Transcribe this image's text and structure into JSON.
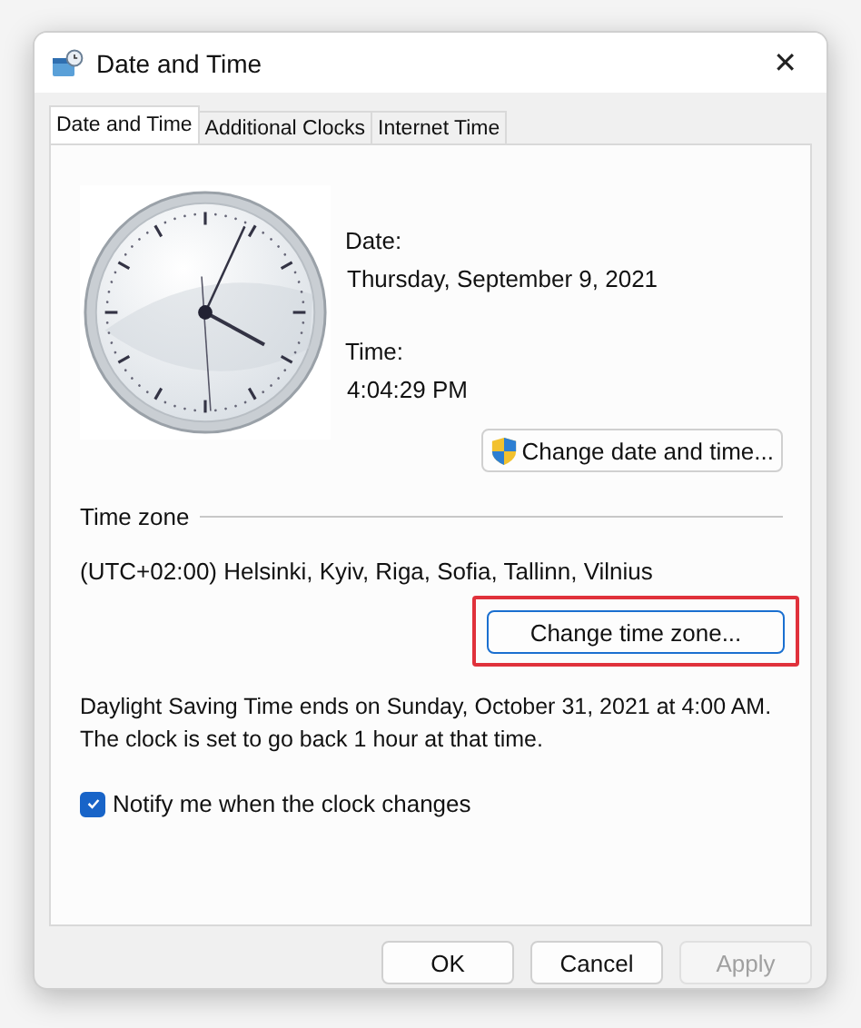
{
  "window": {
    "title": "Date and Time",
    "close": "✕"
  },
  "tabs": [
    {
      "label": "Date and Time",
      "selected": true
    },
    {
      "label": "Additional Clocks",
      "selected": false
    },
    {
      "label": "Internet Time",
      "selected": false
    }
  ],
  "date": {
    "label": "Date:",
    "value": "Thursday, September 9, 2021"
  },
  "time": {
    "label": "Time:",
    "value": "4:04:29 PM"
  },
  "change_date_button": {
    "label": "Change date and time...",
    "shield": true
  },
  "time_zone": {
    "heading": "Time zone",
    "value": "(UTC+02:00) Helsinki, Kyiv, Riga, Sofia, Tallinn, Vilnius"
  },
  "change_zone_button": {
    "label": "Change time zone...",
    "highlighted": true
  },
  "dst_note": [
    "Daylight Saving Time ends on Sunday, October 31, 2021 at 4:00 AM.",
    "The clock is set to go back 1 hour at that time."
  ],
  "notify": {
    "label": "Notify me when the clock changes",
    "checked": true
  },
  "buttons": [
    {
      "label": "OK",
      "disabled": false
    },
    {
      "label": "Cancel",
      "disabled": false
    },
    {
      "label": "Apply",
      "disabled": true
    }
  ]
}
